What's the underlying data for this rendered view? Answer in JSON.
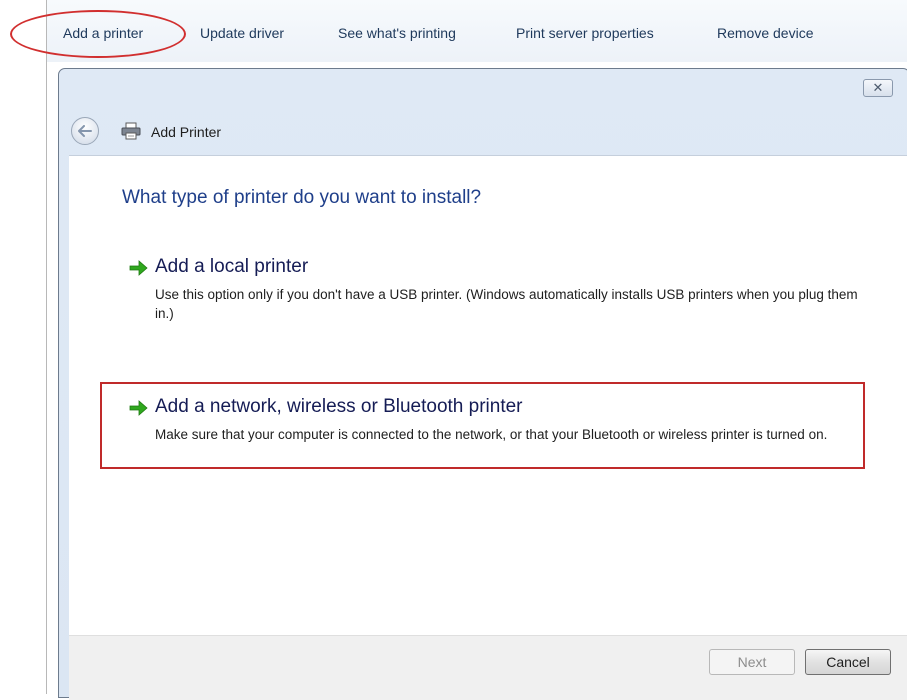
{
  "explorer": {
    "toolbar": {
      "add_printer": "Add a printer",
      "update_driver": "Update driver",
      "see_whats_printing": "See what's printing",
      "print_server_properties": "Print server properties",
      "remove_device": "Remove device"
    }
  },
  "dialog": {
    "close_symbol": "✕",
    "title": "Add Printer",
    "heading": "What type of printer do you want to install?",
    "options": [
      {
        "title": "Add a local printer",
        "description": "Use this option only if you don't have a USB printer. (Windows automatically installs USB printers when you plug them in.)",
        "icon": "green-arrow-icon"
      },
      {
        "title": "Add a network, wireless or Bluetooth printer",
        "description": "Make sure that your computer is connected to the network, or that your Bluetooth or wireless printer is turned on.",
        "icon": "green-arrow-icon",
        "highlighted": true
      }
    ],
    "buttons": {
      "next": "Next",
      "next_enabled": false,
      "cancel": "Cancel"
    }
  },
  "colors": {
    "annotation_red": "#c02a2a",
    "heading_blue": "#1f3f8a",
    "arrow_green": "#2fa81e",
    "dialog_frame": "#dbe6f3"
  }
}
